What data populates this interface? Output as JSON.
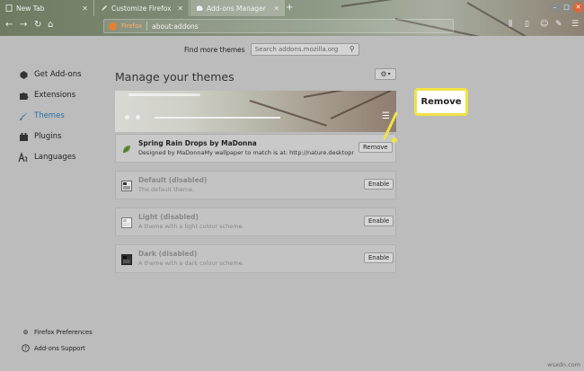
{
  "tabs": [
    {
      "label": "New Tab",
      "icon": "blank-page-icon"
    },
    {
      "label": "Customize Firefox",
      "icon": "pencil-icon"
    },
    {
      "label": "Add-ons Manager",
      "icon": "puzzle-icon",
      "active": true
    }
  ],
  "urlbar": {
    "brand": "Firefox",
    "url": "about:addons"
  },
  "find": {
    "label": "Find more themes",
    "placeholder": "Search addons.mozilla.org"
  },
  "sidebar": {
    "items": [
      {
        "label": "Get Add-ons",
        "icon": "get-addons-icon"
      },
      {
        "label": "Extensions",
        "icon": "puzzle-icon"
      },
      {
        "label": "Themes",
        "icon": "brush-icon",
        "active": true
      },
      {
        "label": "Plugins",
        "icon": "plugin-brick-icon"
      },
      {
        "label": "Languages",
        "icon": "language-icon"
      }
    ],
    "footer": [
      {
        "label": "Firefox Preferences",
        "icon": "gear-icon"
      },
      {
        "label": "Add-ons Support",
        "icon": "help-icon"
      }
    ]
  },
  "main": {
    "heading": "Manage your themes",
    "themes": [
      {
        "name": "Spring Rain Drops by MaDonna",
        "desc": "Designed by MaDonnaMy wallpaper to match is at: http://nature.desktopn...",
        "button": "Remove"
      },
      {
        "name": "Default (disabled)",
        "desc": "The default theme.",
        "button": "Enable"
      },
      {
        "name": "Light (disabled)",
        "desc": "A theme with a light colour scheme.",
        "button": "Enable"
      },
      {
        "name": "Dark (disabled)",
        "desc": "A theme with a dark colour scheme.",
        "button": "Enable"
      }
    ]
  },
  "callout": {
    "label": "Remove"
  },
  "watermark": "wsxdn.com",
  "colors": {
    "accent": "#2d6fa8",
    "callout": "#f1e245",
    "firefox_orange": "#e6802e"
  }
}
